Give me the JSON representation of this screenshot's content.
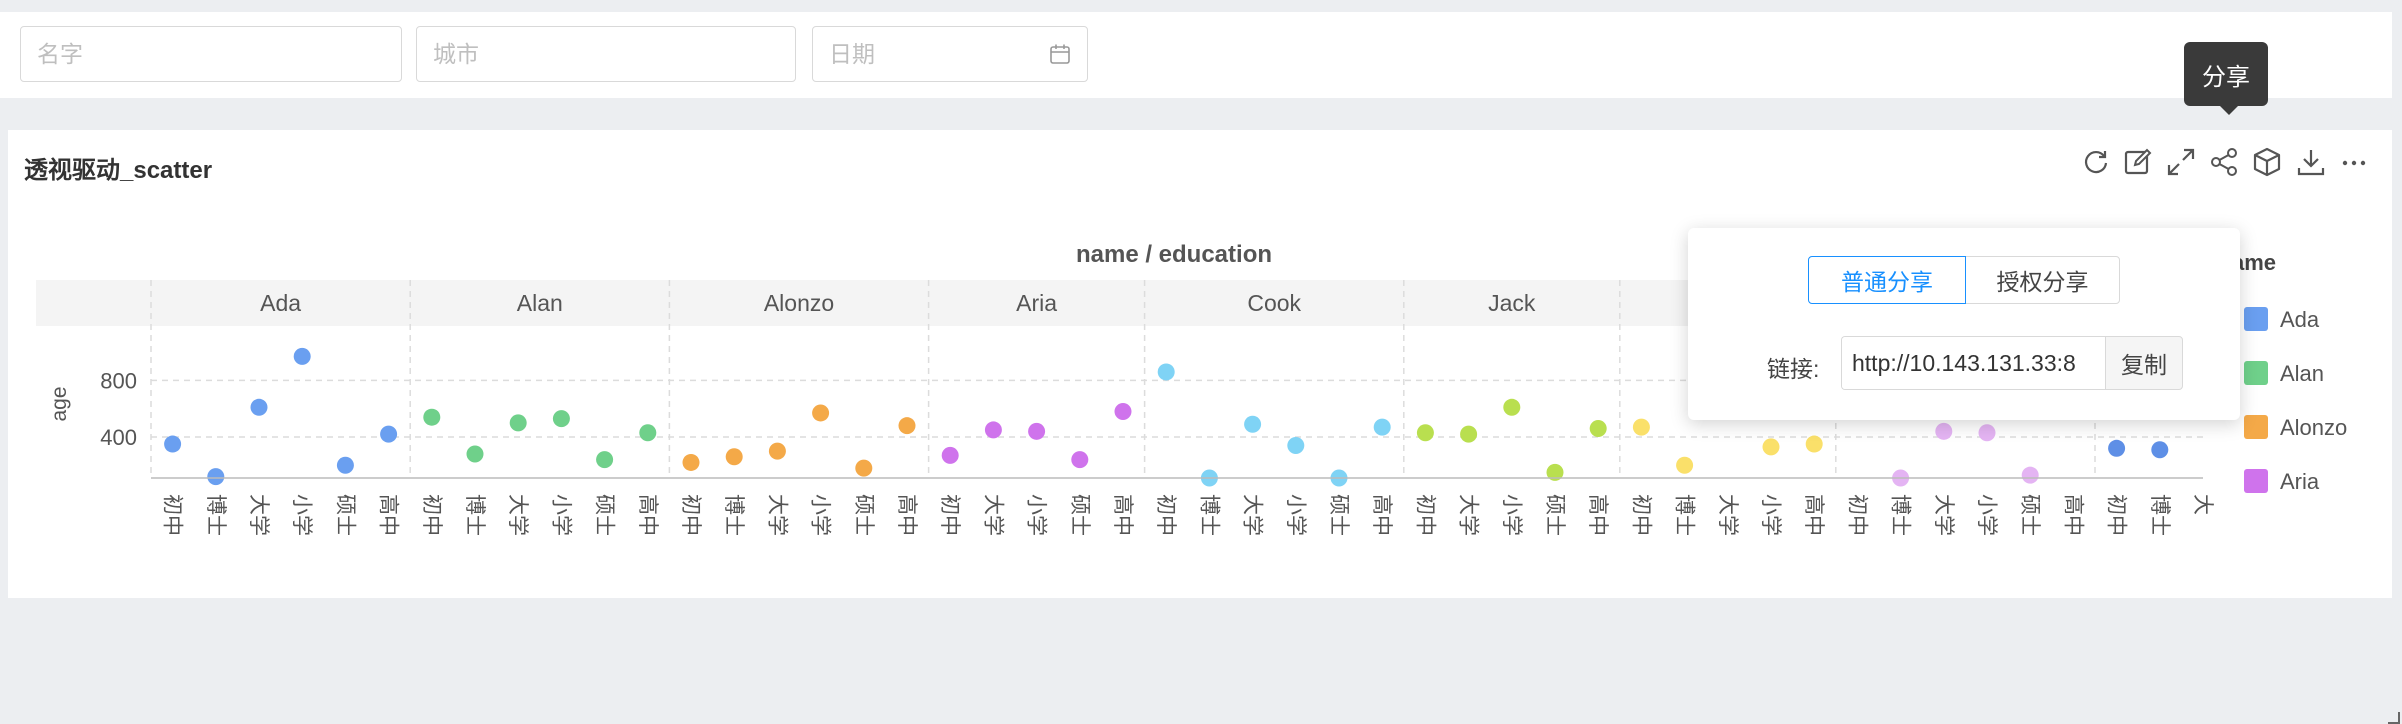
{
  "filters": {
    "name_placeholder": "名字",
    "city_placeholder": "城市",
    "date_placeholder": "日期",
    "date_icon": "calendar-icon"
  },
  "card": {
    "title": "透视驱动_scatter",
    "tools": [
      {
        "name": "refresh-icon"
      },
      {
        "name": "edit-icon"
      },
      {
        "name": "fullscreen-icon"
      },
      {
        "name": "share-icon"
      },
      {
        "name": "cube-icon"
      },
      {
        "name": "download-icon"
      },
      {
        "name": "more-icon"
      }
    ],
    "tooltip": "分享"
  },
  "share_popover": {
    "tabs": [
      "普通分享",
      "授权分享"
    ],
    "active_tab": 0,
    "link_label": "链接:",
    "link_value": "http://10.143.131.33:8",
    "copy_label": "复制"
  },
  "chart_data": {
    "type": "scatter",
    "title": "name / education",
    "ylabel": "age",
    "yticks": [
      400,
      800
    ],
    "ylim": [
      110,
      1100
    ],
    "grid": true,
    "legend_title_visible": "ame",
    "legend_placement": "right",
    "panels": [
      {
        "name": "Ada",
        "categories": [
          "初中",
          "博士",
          "大学",
          "小学",
          "硕士",
          "高中"
        ],
        "values": [
          350,
          120,
          610,
          970,
          200,
          420
        ]
      },
      {
        "name": "Alan",
        "categories": [
          "初中",
          "博士",
          "大学",
          "小学",
          "硕士",
          "高中"
        ],
        "values": [
          540,
          280,
          500,
          530,
          240,
          430
        ]
      },
      {
        "name": "Alonzo",
        "categories": [
          "初中",
          "博士",
          "大学",
          "小学",
          "硕士",
          "高中"
        ],
        "values": [
          220,
          260,
          300,
          570,
          180,
          480
        ]
      },
      {
        "name": "Aria",
        "categories": [
          "初中",
          "大学",
          "小学",
          "硕士",
          "高中"
        ],
        "values": [
          270,
          450,
          440,
          240,
          580
        ]
      },
      {
        "name": "Cook",
        "categories": [
          "初中",
          "博士",
          "大学",
          "小学",
          "硕士",
          "高中"
        ],
        "values": [
          860,
          110,
          490,
          340,
          110,
          470
        ]
      },
      {
        "name": "Jack",
        "categories": [
          "初中",
          "大学",
          "小学",
          "硕士",
          "高中"
        ],
        "values": [
          430,
          420,
          610,
          150,
          460
        ]
      },
      {
        "name": "",
        "categories": [
          "初中",
          "博士",
          "大学",
          "小学",
          "高中"
        ],
        "values": [
          470,
          200,
          null,
          330,
          350
        ]
      },
      {
        "name": "",
        "categories": [
          "初中",
          "博士",
          "大学",
          "小学",
          "硕士",
          "高中"
        ],
        "values": [
          null,
          110,
          440,
          430,
          130,
          null
        ]
      },
      {
        "name": "",
        "categories": [
          "初中",
          "博士",
          "大"
        ],
        "values": [
          320,
          310,
          null
        ]
      }
    ],
    "series_colors": [
      "#6a9ff0",
      "#6fd08a",
      "#f4a948",
      "#cf73ec",
      "#7fd3f5",
      "#b9df4f",
      "#fae06a",
      "#e4b4f3",
      "#5e8fe6"
    ],
    "legend": [
      {
        "name": "Ada",
        "color": "#6a9ff0"
      },
      {
        "name": "Alan",
        "color": "#6fd08a"
      },
      {
        "name": "Alonzo",
        "color": "#f4a948"
      },
      {
        "name": "Aria",
        "color": "#cf73ec"
      }
    ]
  }
}
